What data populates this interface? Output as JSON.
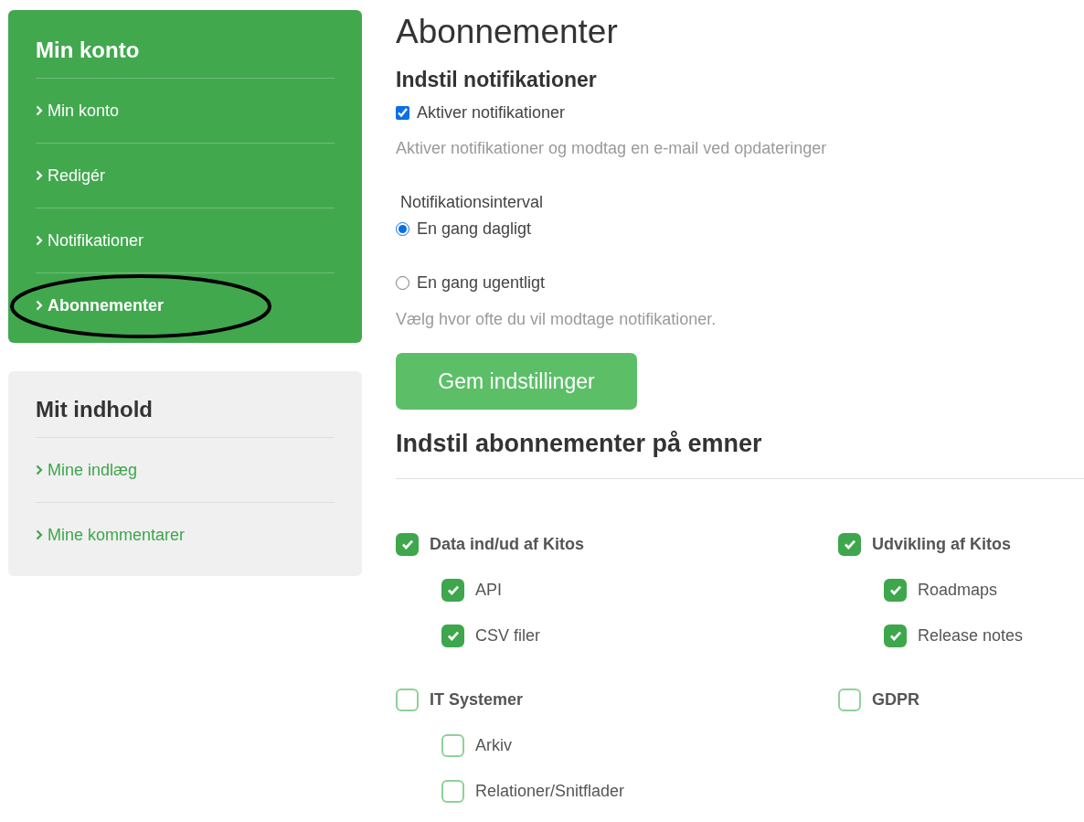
{
  "sidebar": {
    "account": {
      "title": "Min konto",
      "items": [
        {
          "label": "Min konto",
          "selected": false
        },
        {
          "label": "Redigér",
          "selected": false
        },
        {
          "label": "Notifikationer",
          "selected": false
        },
        {
          "label": "Abonnementer",
          "selected": true
        }
      ]
    },
    "content": {
      "title": "Mit indhold",
      "items": [
        {
          "label": "Mine indlæg"
        },
        {
          "label": "Mine kommentarer"
        }
      ]
    }
  },
  "page_title": "Abonnementer",
  "notifications": {
    "heading": "Indstil notifikationer",
    "enable": {
      "label": "Aktiver notifikationer",
      "checked": true
    },
    "help": "Aktiver notifikationer og modtag en e-mail ved opdateringer",
    "interval_label": "Notifikationsinterval",
    "options": [
      {
        "label": "En gang dagligt",
        "selected": true
      },
      {
        "label": "En gang ugentligt",
        "selected": false
      }
    ],
    "interval_help": "Vælg hvor ofte du vil modtage notifikationer.",
    "save_button": "Gem indstillinger"
  },
  "topics": {
    "heading": "Indstil abonnementer på emner",
    "columns": [
      [
        {
          "label": "Data ind/ud af Kitos",
          "checked": true,
          "children": [
            {
              "label": "API",
              "checked": true
            },
            {
              "label": "CSV filer",
              "checked": true
            }
          ]
        },
        {
          "label": "IT Systemer",
          "checked": false,
          "children": [
            {
              "label": "Arkiv",
              "checked": false
            },
            {
              "label": "Relationer/Snitflader",
              "checked": false
            }
          ]
        }
      ],
      [
        {
          "label": "Udvikling af Kitos",
          "checked": true,
          "children": [
            {
              "label": "Roadmaps",
              "checked": true
            },
            {
              "label": "Release notes",
              "checked": true
            }
          ]
        },
        {
          "label": "GDPR",
          "checked": false
        }
      ]
    ]
  }
}
